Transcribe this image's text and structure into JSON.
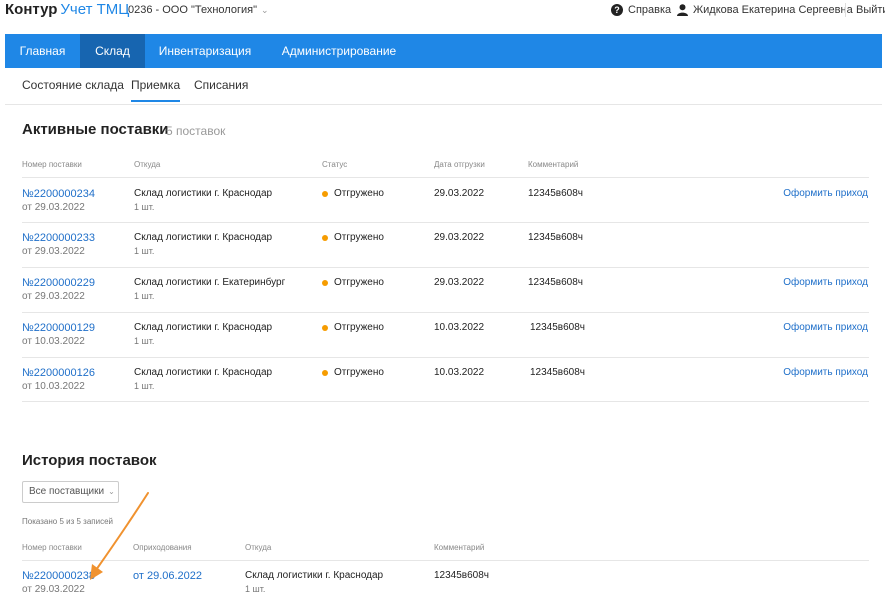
{
  "header": {
    "brand": "Контур",
    "app": "Учет ТМЦ",
    "org": "0236 - ООО \"Технология\"",
    "help": "Справка",
    "user": "Жидкова Екатерина Сергеевна",
    "logout": "Выйти"
  },
  "nav": {
    "tabs": [
      "Главная",
      "Склад",
      "Инвентаризация",
      "Администрирование"
    ],
    "active": "Склад"
  },
  "subnav": {
    "items": [
      "Состояние склада",
      "Приемка",
      "Списания"
    ],
    "active": "Приемка"
  },
  "active": {
    "title": "Активные поставки",
    "count": "5 поставок",
    "columns": [
      "Номер поставки",
      "Откуда",
      "Статус",
      "Дата отгрузки",
      "Комментарий"
    ],
    "rows": [
      {
        "num": "№2200000234",
        "date": "от 29.03.2022",
        "from": "Склад логистики г. Краснодар",
        "qty": "1 шт.",
        "status": "Отгружено",
        "ship": "29.03.2022",
        "comment": "12345в608ч",
        "action": "Оформить приход"
      },
      {
        "num": "№2200000233",
        "date": "от 29.03.2022",
        "from": "Склад логистики г. Краснодар",
        "qty": "1 шт.",
        "status": "Отгружено",
        "ship": "29.03.2022",
        "comment": "12345в608ч",
        "action": ""
      },
      {
        "num": "№2200000229",
        "date": "от 29.03.2022",
        "from": "Склад логистики г. Екатеринбург",
        "qty": "1 шт.",
        "status": "Отгружено",
        "ship": "29.03.2022",
        "comment": "12345в608ч",
        "action": "Оформить приход"
      },
      {
        "num": "№2200000129",
        "date": "от 10.03.2022",
        "from": "Склад логистики г. Краснодар",
        "qty": "1 шт.",
        "status": "Отгружено",
        "ship": "10.03.2022",
        "comment": "12345в608ч",
        "action": "Оформить приход"
      },
      {
        "num": "№2200000126",
        "date": "от 10.03.2022",
        "from": "Склад логистики г. Краснодар",
        "qty": "1 шт.",
        "status": "Отгружено",
        "ship": "10.03.2022",
        "comment": "12345в608ч",
        "action": "Оформить приход"
      }
    ]
  },
  "history": {
    "title": "История поставок",
    "filter": "Все поставщики",
    "shown": "Показано 5 из 5 записей",
    "columns": [
      "Номер поставки",
      "Оприходования",
      "Откуда",
      "Комментарий"
    ],
    "row": {
      "num": "№2200000238",
      "date": "от 29.03.2022",
      "received": "от 29.06.2022",
      "from": "Склад логистики г. Краснодар",
      "qty": "1 шт.",
      "comment": "12345в608ч"
    }
  },
  "colors": {
    "accent": "#1f87e6",
    "active_tab": "#1765b0",
    "status_dot": "#f69c00",
    "annotation_arrow": "#f0922f"
  }
}
